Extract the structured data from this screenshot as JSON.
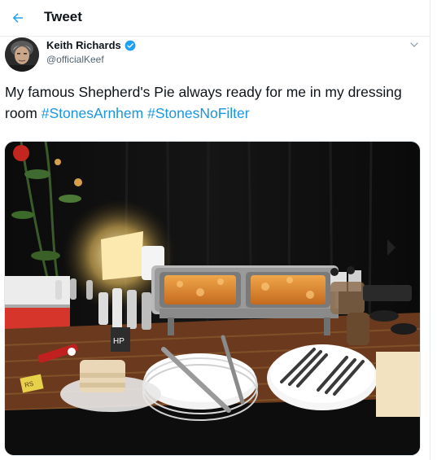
{
  "header": {
    "title": "Tweet"
  },
  "author": {
    "name": "Keith Richards",
    "handle": "@officialKeef"
  },
  "tweet": {
    "text_part1": "My famous Shepherd's Pie always ready for me in my dressing room ",
    "hashtags": [
      "#StonesArnhem",
      "#StonesNoFilter"
    ]
  },
  "photo": {
    "label_hp": "HP",
    "label_box": "RS"
  },
  "colors": {
    "accent": "#1b95e0",
    "verified": "#1da1f2",
    "divider": "#e6ecf0"
  },
  "icons": [
    "back-arrow-icon",
    "verified-badge-icon",
    "chevron-down-icon"
  ]
}
